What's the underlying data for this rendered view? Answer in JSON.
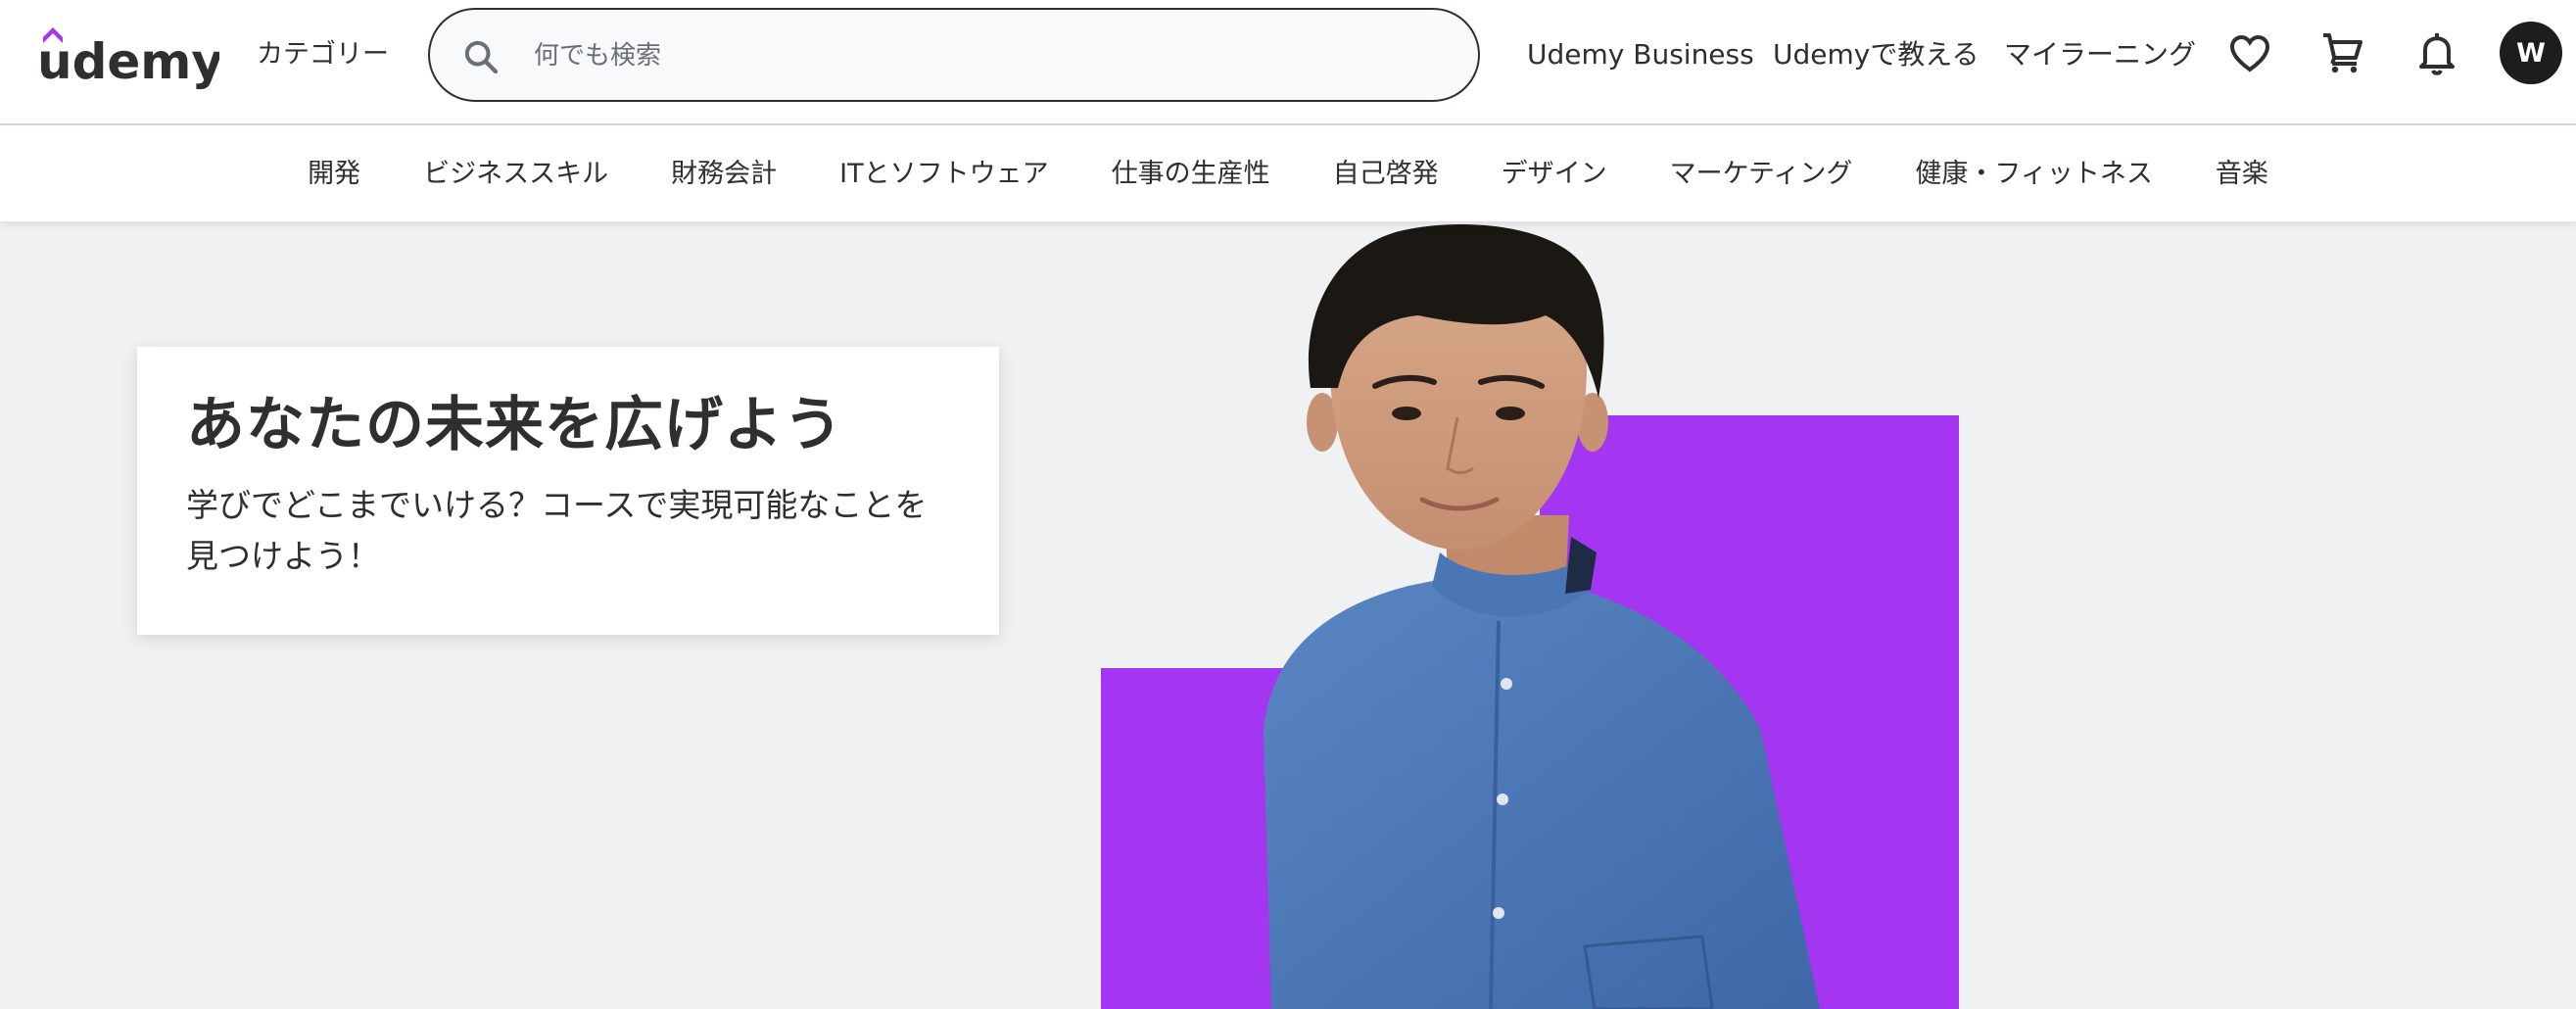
{
  "header": {
    "logo_text": "udemy",
    "categories_label": "カテゴリー",
    "search": {
      "placeholder": "何でも検索",
      "value": ""
    },
    "nav": {
      "business": "Udemy Business",
      "teach": "Udemyで教える",
      "my_learning": "マイラーニング"
    },
    "icons": {
      "wishlist": "heart-icon",
      "cart": "cart-icon",
      "notifications": "bell-icon"
    },
    "avatar_initial": "W"
  },
  "category_bar": {
    "items": [
      "開発",
      "ビジネススキル",
      "財務会計",
      "ITとソフトウェア",
      "仕事の生産性",
      "自己啓発",
      "デザイン",
      "マーケティング",
      "健康・フィットネス",
      "音楽"
    ]
  },
  "hero": {
    "title": "あなたの未来を広げよう",
    "subtitle": "学びでどこまでいける？コースで実現可能なことを見つけよう！"
  },
  "colors": {
    "brand_purple": "#a435f0",
    "text_dark": "#2d2f31",
    "hero_bg": "#f0f1f3"
  }
}
